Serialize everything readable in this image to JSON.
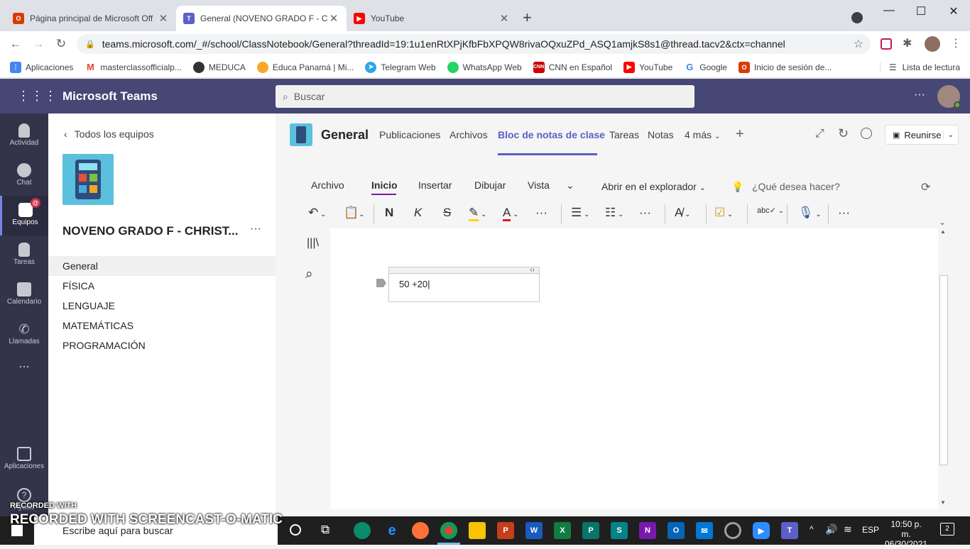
{
  "browser": {
    "tabs": [
      {
        "title": "Página principal de Microsoft Off",
        "icon": "office-icon"
      },
      {
        "title": "General (NOVENO GRADO F - CH",
        "icon": "teams-icon"
      },
      {
        "title": "YouTube",
        "icon": "youtube-icon"
      }
    ],
    "url": "teams.microsoft.com/_#/school/ClassNotebook/General?threadId=19:1u1enRtXPjKfbFbXPQW8rivaOQxuZPd_ASQ1amjkS8s1@thread.tacv2&ctx=channel",
    "bookmarks": [
      "Aplicaciones",
      "masterclassofficialp...",
      "MEDUCA",
      "Educa Panamá | Mi...",
      "Telegram Web",
      "WhatsApp Web",
      "CNN en Español",
      "YouTube",
      "Google",
      "Inicio de sesión de..."
    ],
    "reading_list": "Lista de lectura"
  },
  "teams": {
    "app_name": "Microsoft Teams",
    "search_placeholder": "Buscar",
    "rail": [
      "Actividad",
      "Chat",
      "Equipos",
      "Tareas",
      "Calendario",
      "Llamadas",
      "...",
      "Aplicaciones",
      "Ayuda"
    ],
    "rail_badge": "@",
    "back_label": "Todos los equipos",
    "team_name": "NOVENO GRADO F - CHRIST...",
    "channels": [
      "General",
      "FÍSICA",
      "LENGUAJE",
      "MATEMÁTICAS",
      "PROGRAMACIÓN"
    ],
    "channel_title": "General",
    "tabs": [
      "Publicaciones",
      "Archivos",
      "Bloc de notas de clase",
      "Tareas",
      "Notas",
      "4 más"
    ],
    "meet_button": "Reunirse"
  },
  "onenote": {
    "ribbon_tabs": [
      "Archivo",
      "Inicio",
      "Insertar",
      "Dibujar",
      "Vista"
    ],
    "open_in": "Abrir en el explorador",
    "tell_me": "¿Qué desea hacer?",
    "bold": "N",
    "italic": "K",
    "strike": "S",
    "note_text": "50 +20"
  },
  "taskbar": {
    "search_placeholder": "Escribe aquí para buscar",
    "time": "10:50 p. m.",
    "date": "06/30/2021",
    "lang": "ESP",
    "notif_count": "2"
  },
  "watermark": "RECORDED WITH SCREENCAST-O-MATIC",
  "colors": {
    "teams_header": "#464775",
    "accent": "#5b5fc7",
    "rail": "#33344a"
  }
}
